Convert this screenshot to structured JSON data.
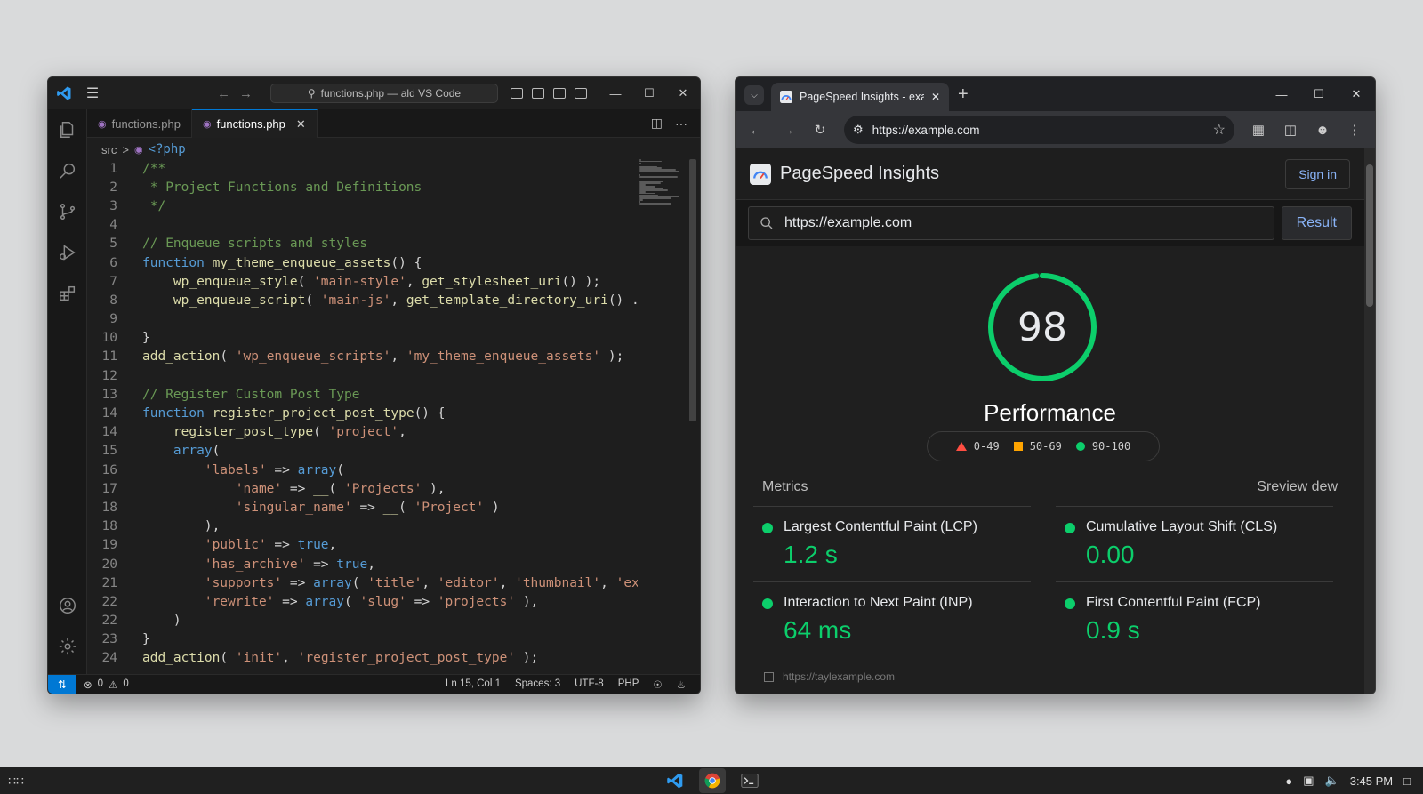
{
  "vscode": {
    "command_center": "functions.php — ald VS Code",
    "tabs": [
      {
        "label": "functions.php",
        "active": false
      },
      {
        "label": "functions.php",
        "active": true
      }
    ],
    "breadcrumb": {
      "folder": "src",
      "separator": ">",
      "symbol": "<?php"
    },
    "lines": [
      {
        "n": "1",
        "parts": [
          {
            "t": "/**",
            "c": "com"
          }
        ]
      },
      {
        "n": "2",
        "parts": [
          {
            "t": " * Project Functions and Definitions",
            "c": "com"
          }
        ]
      },
      {
        "n": "3",
        "parts": [
          {
            "t": " */",
            "c": "com"
          }
        ]
      },
      {
        "n": "4",
        "parts": []
      },
      {
        "n": "5",
        "parts": [
          {
            "t": "// Enqueue scripts and styles",
            "c": "com"
          }
        ]
      },
      {
        "n": "6",
        "parts": [
          {
            "t": "function ",
            "c": "kw"
          },
          {
            "t": "my_theme_enqueue_assets",
            "c": "fn"
          },
          {
            "t": "() {",
            "c": ""
          }
        ]
      },
      {
        "n": "7",
        "parts": [
          {
            "t": "    ",
            "c": ""
          },
          {
            "t": "wp_enqueue_style",
            "c": "fn"
          },
          {
            "t": "( ",
            "c": ""
          },
          {
            "t": "'main-style'",
            "c": "str"
          },
          {
            "t": ", ",
            "c": ""
          },
          {
            "t": "get_stylesheet_uri",
            "c": "fn"
          },
          {
            "t": "() );",
            "c": ""
          }
        ]
      },
      {
        "n": "8",
        "parts": [
          {
            "t": "    ",
            "c": ""
          },
          {
            "t": "wp_enqueue_script",
            "c": "fn"
          },
          {
            "t": "( ",
            "c": ""
          },
          {
            "t": "'main-js'",
            "c": "str"
          },
          {
            "t": ", ",
            "c": ""
          },
          {
            "t": "get_template_directory_uri",
            "c": "fn"
          },
          {
            "t": "() .",
            "c": ""
          }
        ]
      },
      {
        "n": "9",
        "parts": []
      },
      {
        "n": "10",
        "parts": [
          {
            "t": "}",
            "c": ""
          }
        ]
      },
      {
        "n": "11",
        "parts": [
          {
            "t": "add_action",
            "c": "fn"
          },
          {
            "t": "( ",
            "c": ""
          },
          {
            "t": "'wp_enqueue_scripts'",
            "c": "str"
          },
          {
            "t": ", ",
            "c": ""
          },
          {
            "t": "'my_theme_enqueue_assets'",
            "c": "str"
          },
          {
            "t": " );",
            "c": ""
          }
        ]
      },
      {
        "n": "12",
        "parts": []
      },
      {
        "n": "13",
        "parts": [
          {
            "t": "// Register Custom Post Type",
            "c": "com"
          }
        ]
      },
      {
        "n": "14",
        "parts": [
          {
            "t": "function ",
            "c": "kw"
          },
          {
            "t": "register_project_post_type",
            "c": "fn"
          },
          {
            "t": "() {",
            "c": ""
          }
        ]
      },
      {
        "n": "14",
        "parts": [
          {
            "t": "    ",
            "c": ""
          },
          {
            "t": "register_post_type",
            "c": "fn"
          },
          {
            "t": "( ",
            "c": ""
          },
          {
            "t": "'project'",
            "c": "str"
          },
          {
            "t": ",",
            "c": ""
          }
        ]
      },
      {
        "n": "15",
        "parts": [
          {
            "t": "    ",
            "c": ""
          },
          {
            "t": "array",
            "c": "kw"
          },
          {
            "t": "(",
            "c": ""
          }
        ]
      },
      {
        "n": "16",
        "parts": [
          {
            "t": "        ",
            "c": ""
          },
          {
            "t": "'labels'",
            "c": "str"
          },
          {
            "t": " => ",
            "c": ""
          },
          {
            "t": "array",
            "c": "kw"
          },
          {
            "t": "(",
            "c": ""
          }
        ]
      },
      {
        "n": "17",
        "parts": [
          {
            "t": "            ",
            "c": ""
          },
          {
            "t": "'name'",
            "c": "str"
          },
          {
            "t": " => ",
            "c": ""
          },
          {
            "t": "__",
            "c": "fn"
          },
          {
            "t": "( ",
            "c": ""
          },
          {
            "t": "'Projects'",
            "c": "str"
          },
          {
            "t": " ),",
            "c": ""
          }
        ]
      },
      {
        "n": "18",
        "parts": [
          {
            "t": "            ",
            "c": ""
          },
          {
            "t": "'singular_name'",
            "c": "str"
          },
          {
            "t": " => ",
            "c": ""
          },
          {
            "t": "__",
            "c": "fn"
          },
          {
            "t": "( ",
            "c": ""
          },
          {
            "t": "'Project'",
            "c": "str"
          },
          {
            "t": " )",
            "c": ""
          }
        ]
      },
      {
        "n": "18",
        "parts": [
          {
            "t": "        ),",
            "c": ""
          }
        ]
      },
      {
        "n": "19",
        "parts": [
          {
            "t": "        ",
            "c": ""
          },
          {
            "t": "'public'",
            "c": "str"
          },
          {
            "t": " => ",
            "c": ""
          },
          {
            "t": "true",
            "c": "kw"
          },
          {
            "t": ",",
            "c": ""
          }
        ]
      },
      {
        "n": "20",
        "parts": [
          {
            "t": "        ",
            "c": ""
          },
          {
            "t": "'has_archive'",
            "c": "str"
          },
          {
            "t": " => ",
            "c": ""
          },
          {
            "t": "true",
            "c": "kw"
          },
          {
            "t": ",",
            "c": ""
          }
        ]
      },
      {
        "n": "21",
        "parts": [
          {
            "t": "        ",
            "c": ""
          },
          {
            "t": "'supports'",
            "c": "str"
          },
          {
            "t": " => ",
            "c": ""
          },
          {
            "t": "array",
            "c": "kw"
          },
          {
            "t": "( ",
            "c": ""
          },
          {
            "t": "'title'",
            "c": "str"
          },
          {
            "t": ", ",
            "c": ""
          },
          {
            "t": "'editor'",
            "c": "str"
          },
          {
            "t": ", ",
            "c": ""
          },
          {
            "t": "'thumbnail'",
            "c": "str"
          },
          {
            "t": ", ",
            "c": ""
          },
          {
            "t": "'ex",
            "c": "str"
          }
        ]
      },
      {
        "n": "22",
        "parts": [
          {
            "t": "        ",
            "c": ""
          },
          {
            "t": "'rewrite'",
            "c": "str"
          },
          {
            "t": " => ",
            "c": ""
          },
          {
            "t": "array",
            "c": "kw"
          },
          {
            "t": "( ",
            "c": ""
          },
          {
            "t": "'slug'",
            "c": "str"
          },
          {
            "t": " => ",
            "c": ""
          },
          {
            "t": "'projects'",
            "c": "str"
          },
          {
            "t": " ),",
            "c": ""
          }
        ]
      },
      {
        "n": "22",
        "parts": [
          {
            "t": "    )",
            "c": ""
          }
        ]
      },
      {
        "n": "23",
        "parts": [
          {
            "t": "}",
            "c": ""
          }
        ]
      },
      {
        "n": "24",
        "parts": [
          {
            "t": "add_action",
            "c": "fn"
          },
          {
            "t": "( ",
            "c": ""
          },
          {
            "t": "'init'",
            "c": "str"
          },
          {
            "t": ", ",
            "c": ""
          },
          {
            "t": "'register_project_post_type'",
            "c": "str"
          },
          {
            "t": " );",
            "c": ""
          }
        ]
      }
    ],
    "status": {
      "errors": "0",
      "warnings": "0",
      "position": "Ln 15, Col 1",
      "spaces": "Spaces: 3",
      "encoding": "UTF-8",
      "language": "PHP"
    }
  },
  "browser": {
    "tab_title": "PageSpeed Insights - exampl",
    "url": "https://example.com",
    "psi": {
      "title": "PageSpeed Insights",
      "sign_in": "Sign in",
      "search_value": "https://example.com",
      "result_button": "Result",
      "score": "98",
      "score_fraction": 0.98,
      "category": "Performance",
      "legend": [
        {
          "range": "0-49",
          "shape": "triangle",
          "color": "#ff4e42"
        },
        {
          "range": "50-69",
          "shape": "square",
          "color": "#ffa400"
        },
        {
          "range": "90-100",
          "shape": "circle",
          "color": "#0cce6b"
        }
      ],
      "metrics_heading": "Metrics",
      "metrics_link": "Sreview dew",
      "metrics": [
        {
          "name": "Largest Contentful Paint (LCP)",
          "value": "1.2 s"
        },
        {
          "name": "Cumulative Layout Shift (CLS)",
          "value": "0.00"
        },
        {
          "name": "Interaction to Next Paint (INP)",
          "value": "64 ms"
        },
        {
          "name": "First Contentful Paint (FCP)",
          "value": "0.9 s"
        }
      ],
      "footer_text": "https://taylexample.com"
    }
  },
  "taskbar": {
    "time": "3:45 PM"
  },
  "colors": {
    "good": "#0cce6b",
    "vscode_accent": "#0078d4"
  }
}
